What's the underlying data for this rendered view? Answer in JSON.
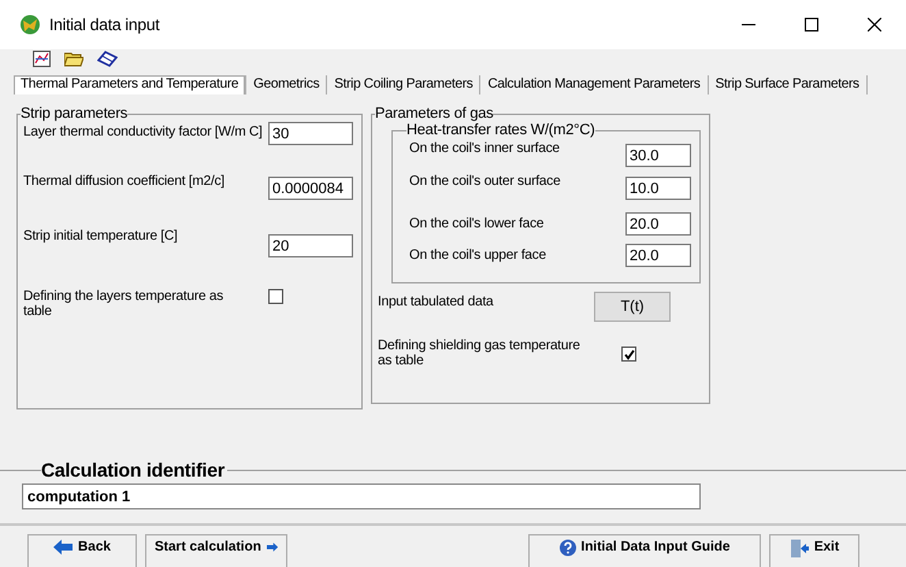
{
  "window": {
    "title": "Initial data input"
  },
  "tabs": [
    {
      "label": "Thermal Parameters and Temperature",
      "selected": true
    },
    {
      "label": "Geometrics",
      "selected": false
    },
    {
      "label": "Strip Coiling Parameters",
      "selected": false
    },
    {
      "label": "Calculation Management Parameters",
      "selected": false
    },
    {
      "label": "Strip Surface Parameters",
      "selected": false
    }
  ],
  "strip_parameters": {
    "title": "Strip parameters",
    "fields": [
      {
        "label": "Layer thermal conductivity factor [W/m C]",
        "value": "30"
      },
      {
        "label": "Thermal diffusion coefficient [m2/c]",
        "value": "0.0000084"
      },
      {
        "label": "Strip initial temperature  [C]",
        "value": "20"
      }
    ],
    "table_option": {
      "label": "Defining the layers temperature as table",
      "checked": false
    }
  },
  "gas_parameters": {
    "title": "Parameters of gas",
    "heat_transfer": {
      "title": "Heat-transfer rates W/(m2°C)",
      "fields": [
        {
          "label": "On the coil's inner surface",
          "value": "30.0"
        },
        {
          "label": "On the coil's outer surface",
          "value": "10.0"
        },
        {
          "label": "On the coil's lower face",
          "value": "20.0"
        },
        {
          "label": "On the coil's upper face",
          "value": "20.0"
        }
      ]
    },
    "tabulated": {
      "label": "Input tabulated data",
      "button": "T(t)"
    },
    "table_option": {
      "label": "Defining shielding gas temperature as table",
      "checked": true
    }
  },
  "calculation_identifier": {
    "title": "Calculation identifier",
    "value": "computation 1"
  },
  "buttons": [
    {
      "label": "Back",
      "kind": "back"
    },
    {
      "label": "Start calculation",
      "kind": "start"
    },
    {
      "label": "Initial Data Input Guide",
      "kind": "help"
    },
    {
      "label": "Exit",
      "kind": "exit"
    }
  ]
}
